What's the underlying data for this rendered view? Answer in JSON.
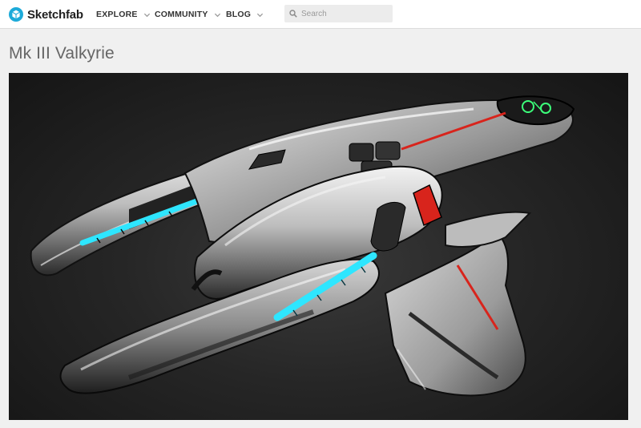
{
  "header": {
    "logo_text": "Sketchfab",
    "nav": [
      {
        "label": "EXPLORE"
      },
      {
        "label": "COMMUNITY"
      },
      {
        "label": "BLOG"
      }
    ],
    "search": {
      "placeholder": "Search",
      "value": ""
    }
  },
  "model": {
    "title": "Mk III Valkyrie"
  },
  "colors": {
    "brand": "#1caad9",
    "viewer_background": "#1e1e1e",
    "accent_cyan": "#2ee6ff",
    "accent_red": "#d8241c",
    "accent_green": "#3cff7a"
  },
  "icons": {
    "logo": "sketchfab-cube-icon",
    "nav_chevron": "chevron-down-icon",
    "search": "search-icon"
  }
}
